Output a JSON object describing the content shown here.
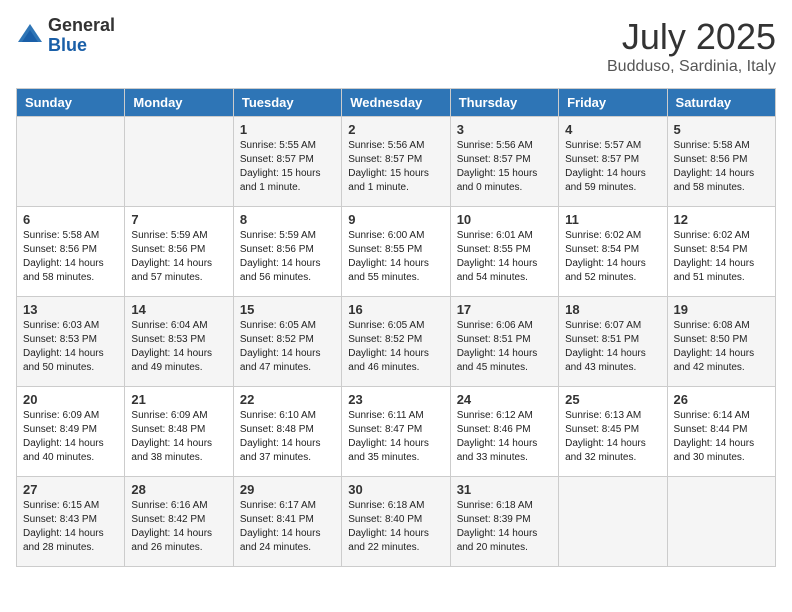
{
  "header": {
    "logo_general": "General",
    "logo_blue": "Blue",
    "month": "July 2025",
    "location": "Budduso, Sardinia, Italy"
  },
  "days_of_week": [
    "Sunday",
    "Monday",
    "Tuesday",
    "Wednesday",
    "Thursday",
    "Friday",
    "Saturday"
  ],
  "weeks": [
    [
      {
        "day": "",
        "info": ""
      },
      {
        "day": "",
        "info": ""
      },
      {
        "day": "1",
        "info": "Sunrise: 5:55 AM\nSunset: 8:57 PM\nDaylight: 15 hours and 1 minute."
      },
      {
        "day": "2",
        "info": "Sunrise: 5:56 AM\nSunset: 8:57 PM\nDaylight: 15 hours and 1 minute."
      },
      {
        "day": "3",
        "info": "Sunrise: 5:56 AM\nSunset: 8:57 PM\nDaylight: 15 hours and 0 minutes."
      },
      {
        "day": "4",
        "info": "Sunrise: 5:57 AM\nSunset: 8:57 PM\nDaylight: 14 hours and 59 minutes."
      },
      {
        "day": "5",
        "info": "Sunrise: 5:58 AM\nSunset: 8:56 PM\nDaylight: 14 hours and 58 minutes."
      }
    ],
    [
      {
        "day": "6",
        "info": "Sunrise: 5:58 AM\nSunset: 8:56 PM\nDaylight: 14 hours and 58 minutes."
      },
      {
        "day": "7",
        "info": "Sunrise: 5:59 AM\nSunset: 8:56 PM\nDaylight: 14 hours and 57 minutes."
      },
      {
        "day": "8",
        "info": "Sunrise: 5:59 AM\nSunset: 8:56 PM\nDaylight: 14 hours and 56 minutes."
      },
      {
        "day": "9",
        "info": "Sunrise: 6:00 AM\nSunset: 8:55 PM\nDaylight: 14 hours and 55 minutes."
      },
      {
        "day": "10",
        "info": "Sunrise: 6:01 AM\nSunset: 8:55 PM\nDaylight: 14 hours and 54 minutes."
      },
      {
        "day": "11",
        "info": "Sunrise: 6:02 AM\nSunset: 8:54 PM\nDaylight: 14 hours and 52 minutes."
      },
      {
        "day": "12",
        "info": "Sunrise: 6:02 AM\nSunset: 8:54 PM\nDaylight: 14 hours and 51 minutes."
      }
    ],
    [
      {
        "day": "13",
        "info": "Sunrise: 6:03 AM\nSunset: 8:53 PM\nDaylight: 14 hours and 50 minutes."
      },
      {
        "day": "14",
        "info": "Sunrise: 6:04 AM\nSunset: 8:53 PM\nDaylight: 14 hours and 49 minutes."
      },
      {
        "day": "15",
        "info": "Sunrise: 6:05 AM\nSunset: 8:52 PM\nDaylight: 14 hours and 47 minutes."
      },
      {
        "day": "16",
        "info": "Sunrise: 6:05 AM\nSunset: 8:52 PM\nDaylight: 14 hours and 46 minutes."
      },
      {
        "day": "17",
        "info": "Sunrise: 6:06 AM\nSunset: 8:51 PM\nDaylight: 14 hours and 45 minutes."
      },
      {
        "day": "18",
        "info": "Sunrise: 6:07 AM\nSunset: 8:51 PM\nDaylight: 14 hours and 43 minutes."
      },
      {
        "day": "19",
        "info": "Sunrise: 6:08 AM\nSunset: 8:50 PM\nDaylight: 14 hours and 42 minutes."
      }
    ],
    [
      {
        "day": "20",
        "info": "Sunrise: 6:09 AM\nSunset: 8:49 PM\nDaylight: 14 hours and 40 minutes."
      },
      {
        "day": "21",
        "info": "Sunrise: 6:09 AM\nSunset: 8:48 PM\nDaylight: 14 hours and 38 minutes."
      },
      {
        "day": "22",
        "info": "Sunrise: 6:10 AM\nSunset: 8:48 PM\nDaylight: 14 hours and 37 minutes."
      },
      {
        "day": "23",
        "info": "Sunrise: 6:11 AM\nSunset: 8:47 PM\nDaylight: 14 hours and 35 minutes."
      },
      {
        "day": "24",
        "info": "Sunrise: 6:12 AM\nSunset: 8:46 PM\nDaylight: 14 hours and 33 minutes."
      },
      {
        "day": "25",
        "info": "Sunrise: 6:13 AM\nSunset: 8:45 PM\nDaylight: 14 hours and 32 minutes."
      },
      {
        "day": "26",
        "info": "Sunrise: 6:14 AM\nSunset: 8:44 PM\nDaylight: 14 hours and 30 minutes."
      }
    ],
    [
      {
        "day": "27",
        "info": "Sunrise: 6:15 AM\nSunset: 8:43 PM\nDaylight: 14 hours and 28 minutes."
      },
      {
        "day": "28",
        "info": "Sunrise: 6:16 AM\nSunset: 8:42 PM\nDaylight: 14 hours and 26 minutes."
      },
      {
        "day": "29",
        "info": "Sunrise: 6:17 AM\nSunset: 8:41 PM\nDaylight: 14 hours and 24 minutes."
      },
      {
        "day": "30",
        "info": "Sunrise: 6:18 AM\nSunset: 8:40 PM\nDaylight: 14 hours and 22 minutes."
      },
      {
        "day": "31",
        "info": "Sunrise: 6:18 AM\nSunset: 8:39 PM\nDaylight: 14 hours and 20 minutes."
      },
      {
        "day": "",
        "info": ""
      },
      {
        "day": "",
        "info": ""
      }
    ]
  ]
}
